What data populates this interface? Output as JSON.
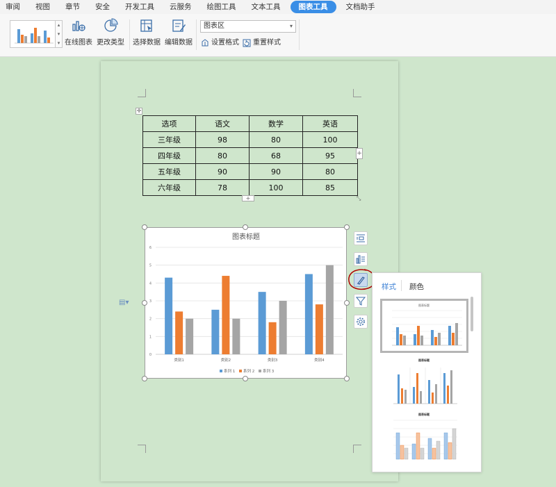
{
  "menu": {
    "items": [
      "审阅",
      "视图",
      "章节",
      "安全",
      "开发工具",
      "云服务",
      "绘图工具",
      "文本工具",
      "图表工具",
      "文档助手"
    ],
    "active": "图表工具"
  },
  "ribbon": {
    "online_chart": "在线图表",
    "change_type": "更改类型",
    "select_data": "选择数据",
    "edit_data": "编辑数据",
    "chart_area_select": "图表区",
    "set_format": "设置格式",
    "reset_style": "重置样式"
  },
  "table": {
    "headers": [
      "选项",
      "语文",
      "数学",
      "英语"
    ],
    "rows": [
      [
        "三年级",
        "98",
        "80",
        "100"
      ],
      [
        "四年级",
        "80",
        "68",
        "95"
      ],
      [
        "五年级",
        "90",
        "90",
        "80"
      ],
      [
        "六年级",
        "78",
        "100",
        "85"
      ]
    ]
  },
  "chart_data": {
    "type": "bar",
    "title": "图表标题",
    "categories": [
      "类别1",
      "类别2",
      "类别3",
      "类别4"
    ],
    "series": [
      {
        "name": "系列 1",
        "values": [
          4.3,
          2.5,
          3.5,
          4.5
        ]
      },
      {
        "name": "系列 2",
        "values": [
          2.4,
          4.4,
          1.8,
          2.8
        ]
      },
      {
        "name": "系列 3",
        "values": [
          2,
          2,
          3,
          5
        ]
      }
    ],
    "ylim": [
      0,
      6
    ],
    "yticks": [
      "0",
      "1",
      "2",
      "3",
      "4",
      "5",
      "6"
    ],
    "grid": true,
    "legend": "bottom",
    "colors": [
      "#5b9bd5",
      "#ed7d31",
      "#a5a5a5"
    ]
  },
  "panel": {
    "tab_style": "样式",
    "tab_color": "颜色",
    "thumb1_title": "图表标题",
    "thumb2_title": "图表标题",
    "thumb3_title": "图表标题"
  },
  "colors": {
    "accent": "#3a8ee6",
    "page_bg": "#cfe6cc",
    "annotation_red": "#b00000"
  }
}
